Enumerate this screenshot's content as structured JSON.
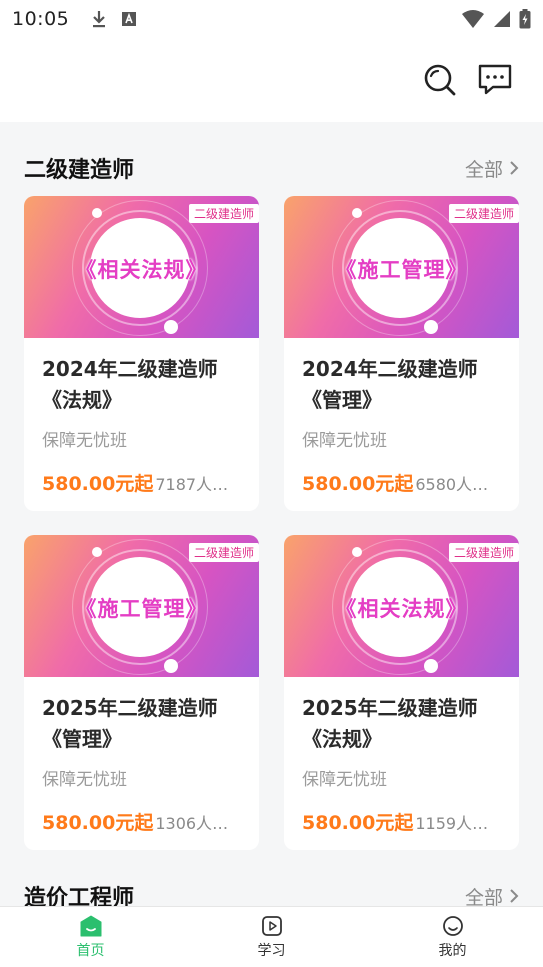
{
  "status_bar": {
    "time": "10:05"
  },
  "sections": [
    {
      "title": "二级建造师",
      "more_label": "全部",
      "courses": [
        {
          "thumb_tag": "二级建造师",
          "thumb_text": "《相关法规》",
          "title": "2024年二级建造师《法规》",
          "subtitle": "保障无忧班",
          "price": "580.00元起",
          "views": "7187人浏…"
        },
        {
          "thumb_tag": "二级建造师",
          "thumb_text": "《施工管理》",
          "title": "2024年二级建造师《管理》",
          "subtitle": "保障无忧班",
          "price": "580.00元起",
          "views": "6580人浏…"
        },
        {
          "thumb_tag": "二级建造师",
          "thumb_text": "《施工管理》",
          "title": "2025年二级建造师《管理》",
          "subtitle": "保障无忧班",
          "price": "580.00元起",
          "views": "1306人浏…"
        },
        {
          "thumb_tag": "二级建造师",
          "thumb_text": "《相关法规》",
          "title": "2025年二级建造师《法规》",
          "subtitle": "保障无忧班",
          "price": "580.00元起",
          "views": "1159人浏…"
        }
      ]
    },
    {
      "title": "造价工程师",
      "more_label": "全部"
    }
  ],
  "bottom_nav": [
    {
      "label": "首页",
      "icon": "home-icon",
      "active": true
    },
    {
      "label": "学习",
      "icon": "play-icon",
      "active": false
    },
    {
      "label": "我的",
      "icon": "profile-icon",
      "active": false
    }
  ],
  "colors": {
    "accent": "#2bbf6e",
    "price": "#ff7a1a"
  }
}
